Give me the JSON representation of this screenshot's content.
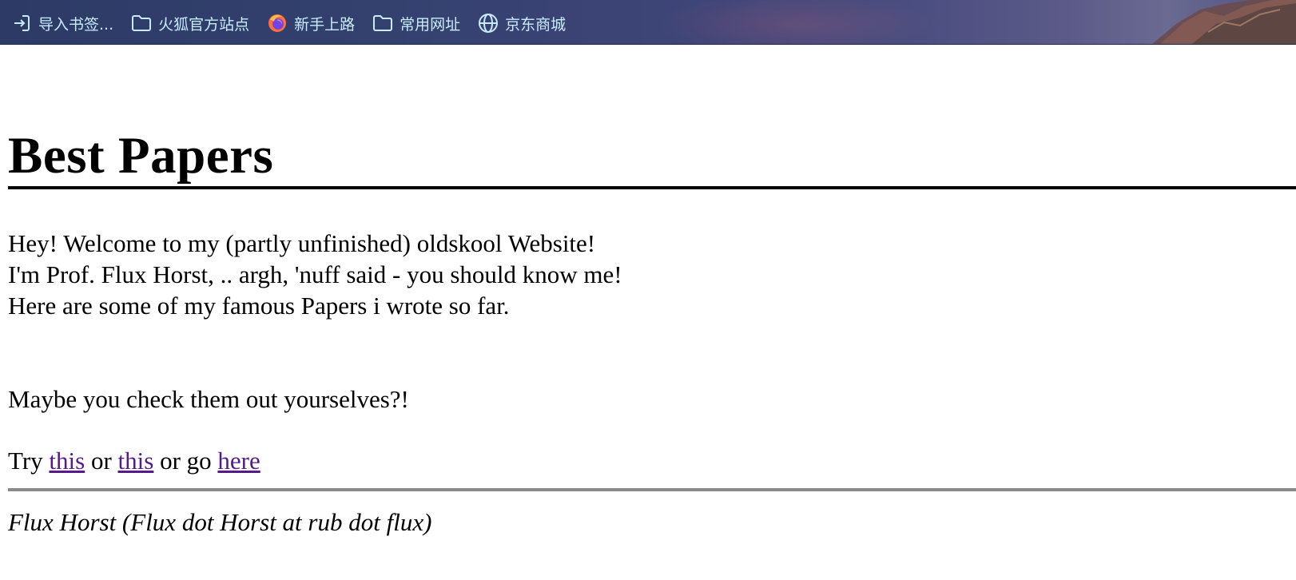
{
  "bookmarks": [
    {
      "label": "导入书签...",
      "icon": "import-icon"
    },
    {
      "label": "火狐官方站点",
      "icon": "folder-icon"
    },
    {
      "label": "新手上路",
      "icon": "firefox-icon"
    },
    {
      "label": "常用网址",
      "icon": "folder-icon"
    },
    {
      "label": "京东商城",
      "icon": "globe-icon"
    }
  ],
  "page": {
    "title": "Best Papers",
    "intro": [
      "Hey! Welcome to my (partly unfinished) oldskool Website!",
      "I'm Prof. Flux Horst, .. argh, 'nuff said - you should know me!",
      "Here are some of my famous Papers i wrote so far."
    ],
    "check": "Maybe you check them out yourselves?!",
    "try": {
      "prefix": "Try ",
      "link1": "this",
      "mid1": " or ",
      "link2": "this",
      "mid2": " or go ",
      "link3": "here"
    },
    "footer": "Flux Horst (Flux dot Horst at rub dot flux)"
  },
  "colors": {
    "link_visited": "#551a8b",
    "bookmark_text": "#c8ecff"
  }
}
